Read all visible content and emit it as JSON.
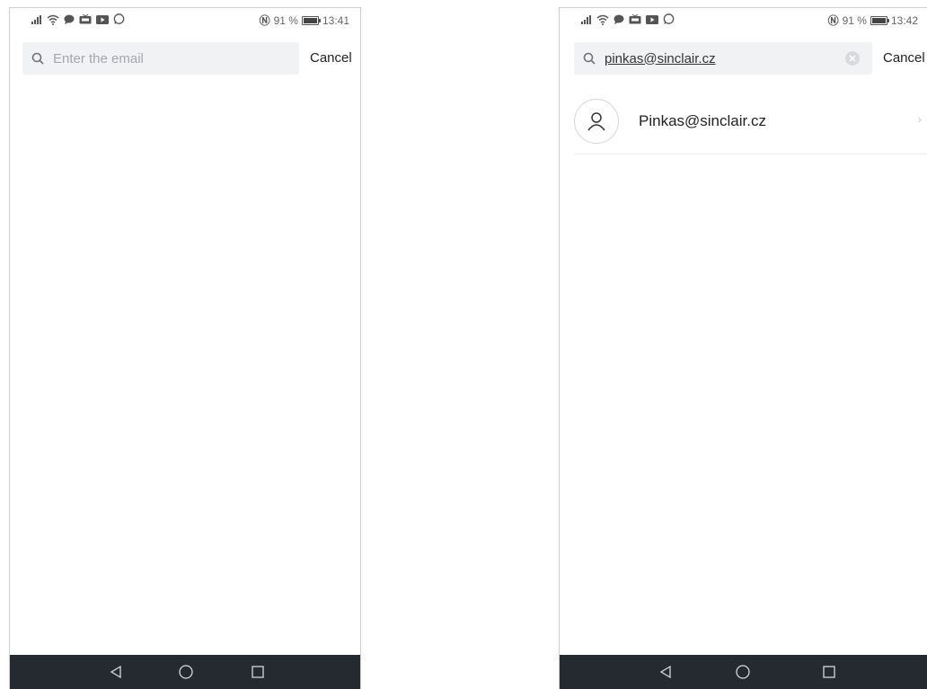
{
  "screens": [
    {
      "status": {
        "battery_percent": "91 %",
        "time": "13:41"
      },
      "search": {
        "placeholder": "Enter the email",
        "value": ""
      },
      "cancel_label": "Cancel"
    },
    {
      "status": {
        "battery_percent": "91 %",
        "time": "13:42"
      },
      "search": {
        "placeholder": "Enter the email",
        "value": "pinkas@sinclair.cz"
      },
      "cancel_label": "Cancel",
      "results": [
        {
          "label": "Pinkas@sinclair.cz"
        }
      ]
    }
  ],
  "icons": {
    "status": [
      "signal-icon",
      "wifi-icon",
      "chat-icon",
      "tv-icon",
      "video-icon",
      "whatsapp-icon"
    ],
    "nfc": "nfc-icon",
    "battery": "battery-icon",
    "search": "search-icon",
    "clear": "clear-icon",
    "avatar": "user-icon",
    "chevron": "chevron-right-icon",
    "nav": [
      "back-icon",
      "home-icon",
      "recents-icon"
    ]
  },
  "colors": {
    "nav_bar": "#252a31",
    "search_bg": "#f1f2f4",
    "placeholder": "#a3a7ad"
  }
}
